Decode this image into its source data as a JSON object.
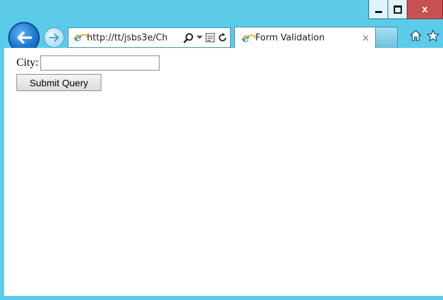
{
  "browser": {
    "address": "http://tt/jsbs3e/Ch",
    "tab_title": "Form Validation",
    "tab_close": "×",
    "window_close": "x"
  },
  "icons": {
    "back": "back-arrow-icon",
    "forward": "forward-arrow-icon",
    "search": "search-icon",
    "dropdown": "chevron-down-icon",
    "compat": "compatibility-view-icon",
    "refresh": "refresh-icon",
    "home": "home-icon",
    "favorites": "star-icon",
    "browser_logo": "ie-logo-icon"
  },
  "form": {
    "city_label": "City:",
    "city_value": "",
    "submit_label": "Submit Query"
  },
  "colors": {
    "frame": "#5ccbea",
    "close_button": "#c75050",
    "back_button": "#1f78d1"
  }
}
